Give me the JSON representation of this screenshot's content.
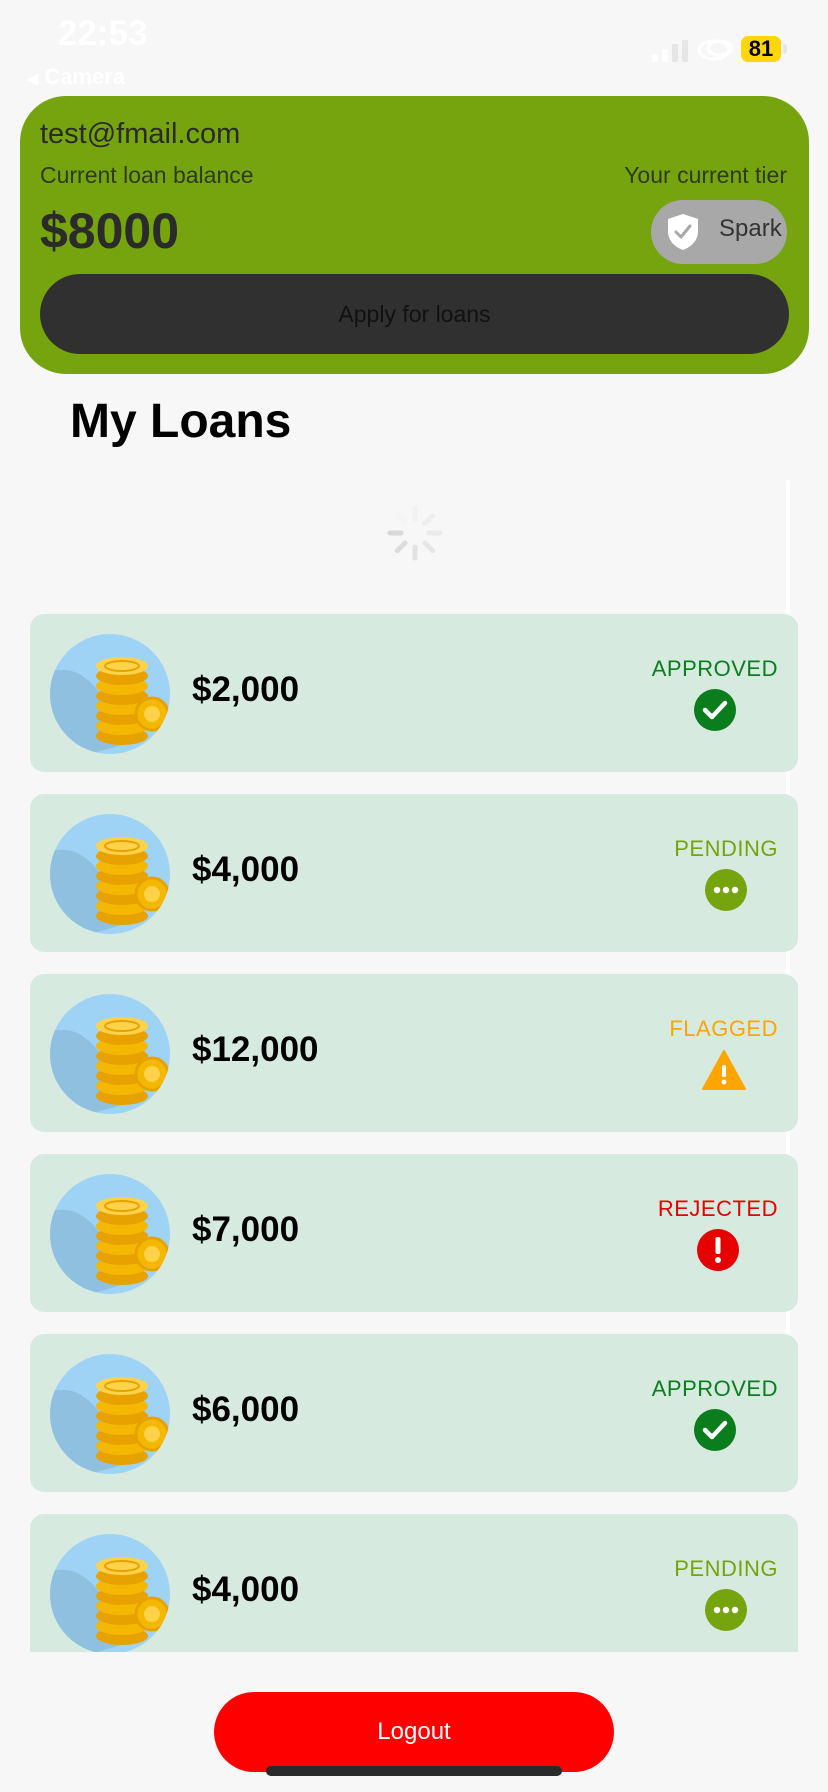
{
  "status_bar": {
    "time": "22:53",
    "back_label": "Camera",
    "battery": "81"
  },
  "account": {
    "email": "test@fmail.com",
    "balance_label": "Current loan balance",
    "balance_value": "$8000",
    "tier_label": "Your current tier",
    "tier_name": "Spark",
    "apply_label": "Apply for loans"
  },
  "section_title": "My Loans",
  "status_colors": {
    "approved": "#0a7d1c",
    "pending": "#76a40f",
    "flagged": "#ffa500",
    "rejected": "#e60000"
  },
  "loans": [
    {
      "amount": "$2,000",
      "status": "APPROVED",
      "status_key": "approved",
      "icon": "checkmark-circle-icon"
    },
    {
      "amount": "$4,000",
      "status": "PENDING",
      "status_key": "pending",
      "icon": "ellipsis-circle-icon"
    },
    {
      "amount": "$12,000",
      "status": "FLAGGED",
      "status_key": "flagged",
      "icon": "warning-triangle-icon"
    },
    {
      "amount": "$7,000",
      "status": "REJECTED",
      "status_key": "rejected",
      "icon": "exclamation-circle-icon"
    },
    {
      "amount": "$6,000",
      "status": "APPROVED",
      "status_key": "approved",
      "icon": "checkmark-circle-icon"
    },
    {
      "amount": "$4,000",
      "status": "PENDING",
      "status_key": "pending",
      "icon": "ellipsis-circle-icon"
    }
  ],
  "logout_label": "Logout"
}
